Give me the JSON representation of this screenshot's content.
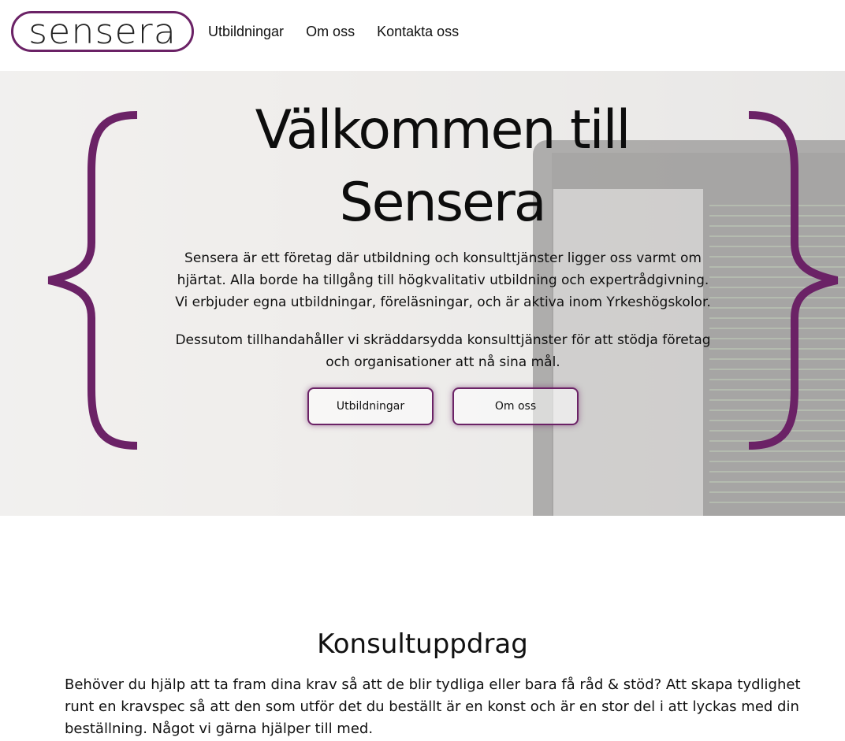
{
  "header": {
    "logo_text": "sensera",
    "nav": [
      "Utbildningar",
      "Om oss",
      "Kontakta oss"
    ]
  },
  "hero": {
    "title": "Välkommen till Sensera",
    "paragraph1": "Sensera är ett företag där utbildning och konsulttjänster ligger oss varmt om hjärtat. Alla borde ha tillgång till högkvalitativ utbildning och expertrådgivning. Vi erbjuder egna utbildningar, föreläsningar, och är aktiva inom Yrkeshögskolor.",
    "paragraph2": "Dessutom tillhandahåller vi skräddarsydda konsulttjänster för att stödja företag och organisationer att nå sina mål.",
    "buttons": [
      "Utbildningar",
      "Om oss"
    ]
  },
  "section": {
    "title": "Konsultuppdrag",
    "text": "Behöver du hjälp att ta fram dina krav så att de blir tydliga eller bara få råd & stöd? Att skapa tydlighet runt en kravspec så att den som utför det du beställt är en konst och är en stor del i att lyckas med din beställning. Något vi gärna hjälper till med."
  },
  "colors": {
    "brand": "#6b2266",
    "text": "#111111"
  }
}
